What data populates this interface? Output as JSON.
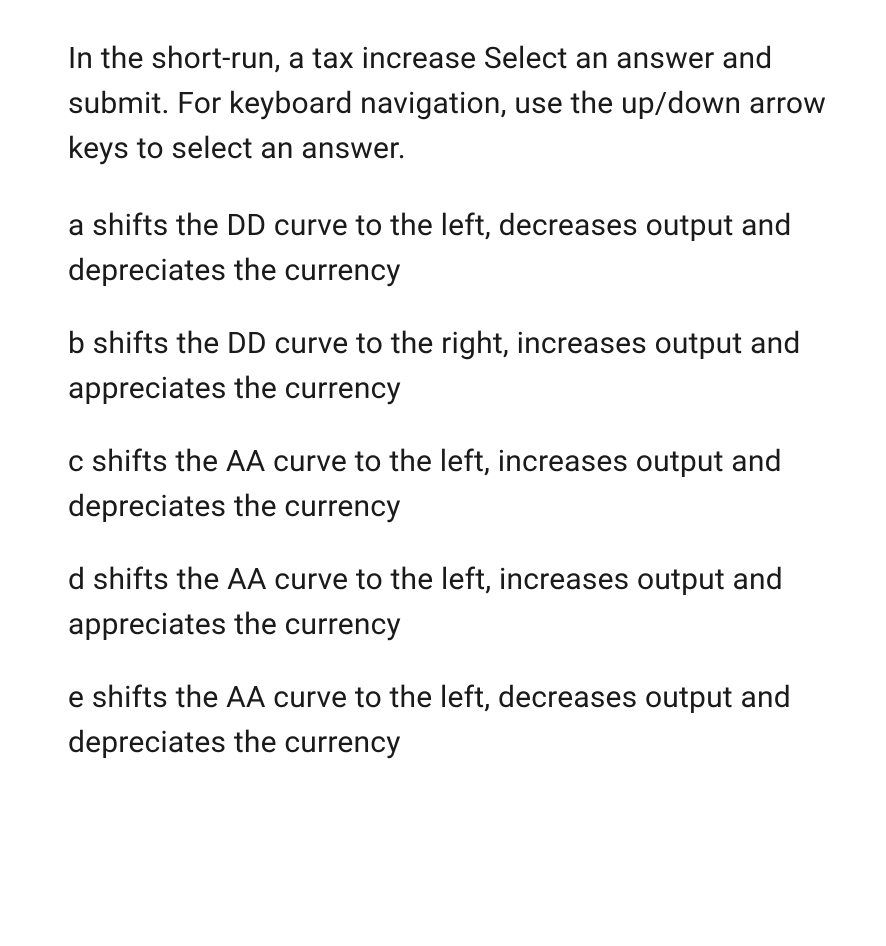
{
  "question": {
    "prompt": "In the short-run, a tax increase Select an answer and submit. For keyboard navigation, use the up/down arrow keys to select an answer."
  },
  "options": [
    {
      "key": "a",
      "text": "a shifts the DD curve to the left, decreases output and depreciates the currency"
    },
    {
      "key": "b",
      "text": "b shifts the DD curve to the right, increases output and appreciates the currency"
    },
    {
      "key": "c",
      "text": "c shifts the AA curve to the left, increases output and depreciates the currency"
    },
    {
      "key": "d",
      "text": "d shifts the AA curve to the left, increases output and appreciates the currency"
    },
    {
      "key": "e",
      "text": "e shifts the AA curve to the left, decreases output and depreciates the currency"
    }
  ]
}
